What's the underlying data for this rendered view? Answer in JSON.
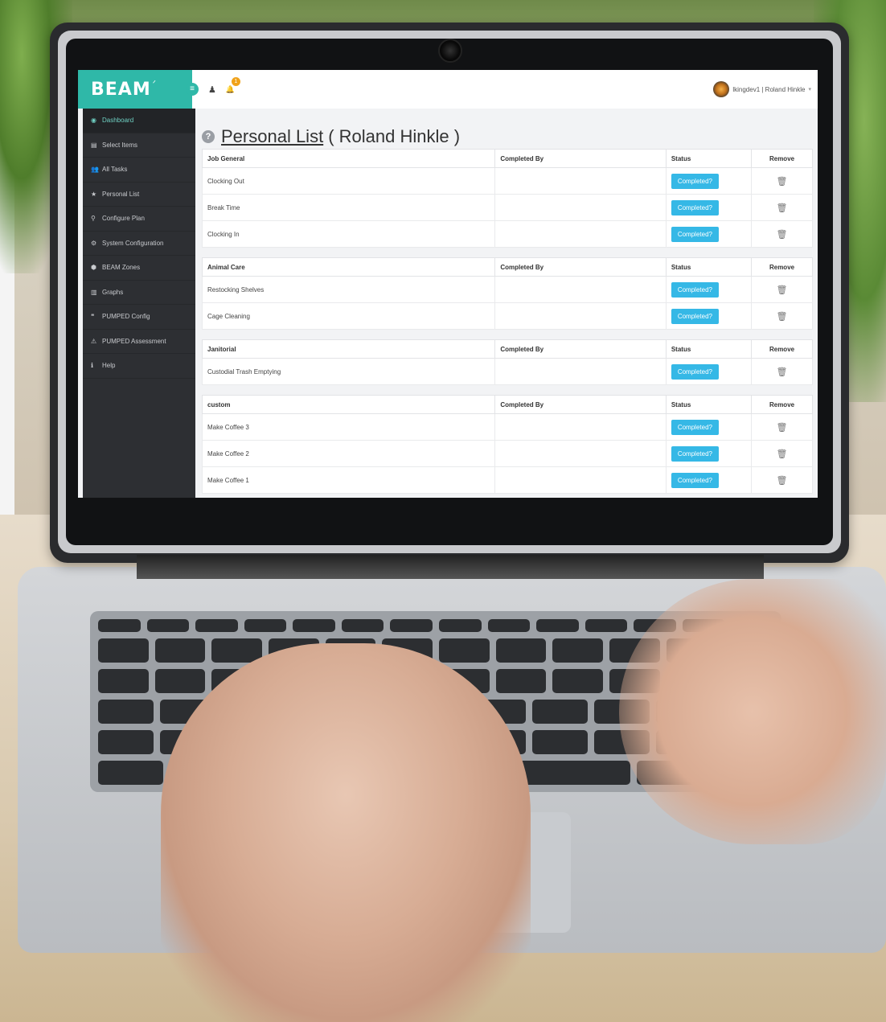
{
  "app": {
    "brand": "BEAM",
    "brand_spark": "ᐟ"
  },
  "topbar": {
    "menu_icon": "≡",
    "user_icon": "♟",
    "bell_icon": "🔔",
    "notification_count": "1",
    "user_label": "lkingdev1 | Roland Hinkle",
    "caret": "▾"
  },
  "sidebar": {
    "items": [
      {
        "icon": "◉",
        "label": "Dashboard"
      },
      {
        "icon": "▤",
        "label": "Select Items"
      },
      {
        "icon": "👥",
        "label": "All Tasks"
      },
      {
        "icon": "★",
        "label": "Personal List"
      },
      {
        "icon": "⚲",
        "label": "Configure Plan"
      },
      {
        "icon": "⚙",
        "label": "System Configuration"
      },
      {
        "icon": "⬢",
        "label": "BEAM Zones"
      },
      {
        "icon": "▥",
        "label": "Graphs"
      },
      {
        "icon": "❝",
        "label": "PUMPED Config"
      },
      {
        "icon": "⚠",
        "label": "PUMPED Assessment"
      },
      {
        "icon": "ℹ",
        "label": "Help"
      }
    ]
  },
  "page": {
    "help_icon": "?",
    "title_link": "Personal List",
    "title_suffix": "( Roland Hinkle )"
  },
  "table_headers": {
    "completed_by": "Completed By",
    "status": "Status",
    "remove": "Remove"
  },
  "button_label": "Completed?",
  "trash_icon": "🗑",
  "groups": [
    {
      "name": "Job General",
      "tasks": [
        "Clocking Out",
        "Break Time",
        "Clocking In"
      ]
    },
    {
      "name": "Animal Care",
      "tasks": [
        "Restocking Shelves",
        "Cage Cleaning"
      ]
    },
    {
      "name": "Janitorial",
      "tasks": [
        "Custodial Trash Emptying"
      ]
    },
    {
      "name": "custom",
      "tasks": [
        "Make Coffee 3",
        "Make Coffee 2",
        "Make Coffee 1"
      ]
    }
  ],
  "colors": {
    "brand": "#2fb8a8",
    "button": "#35b8e6",
    "sidebar": "#2d2f33",
    "badge": "#f0a21a"
  }
}
